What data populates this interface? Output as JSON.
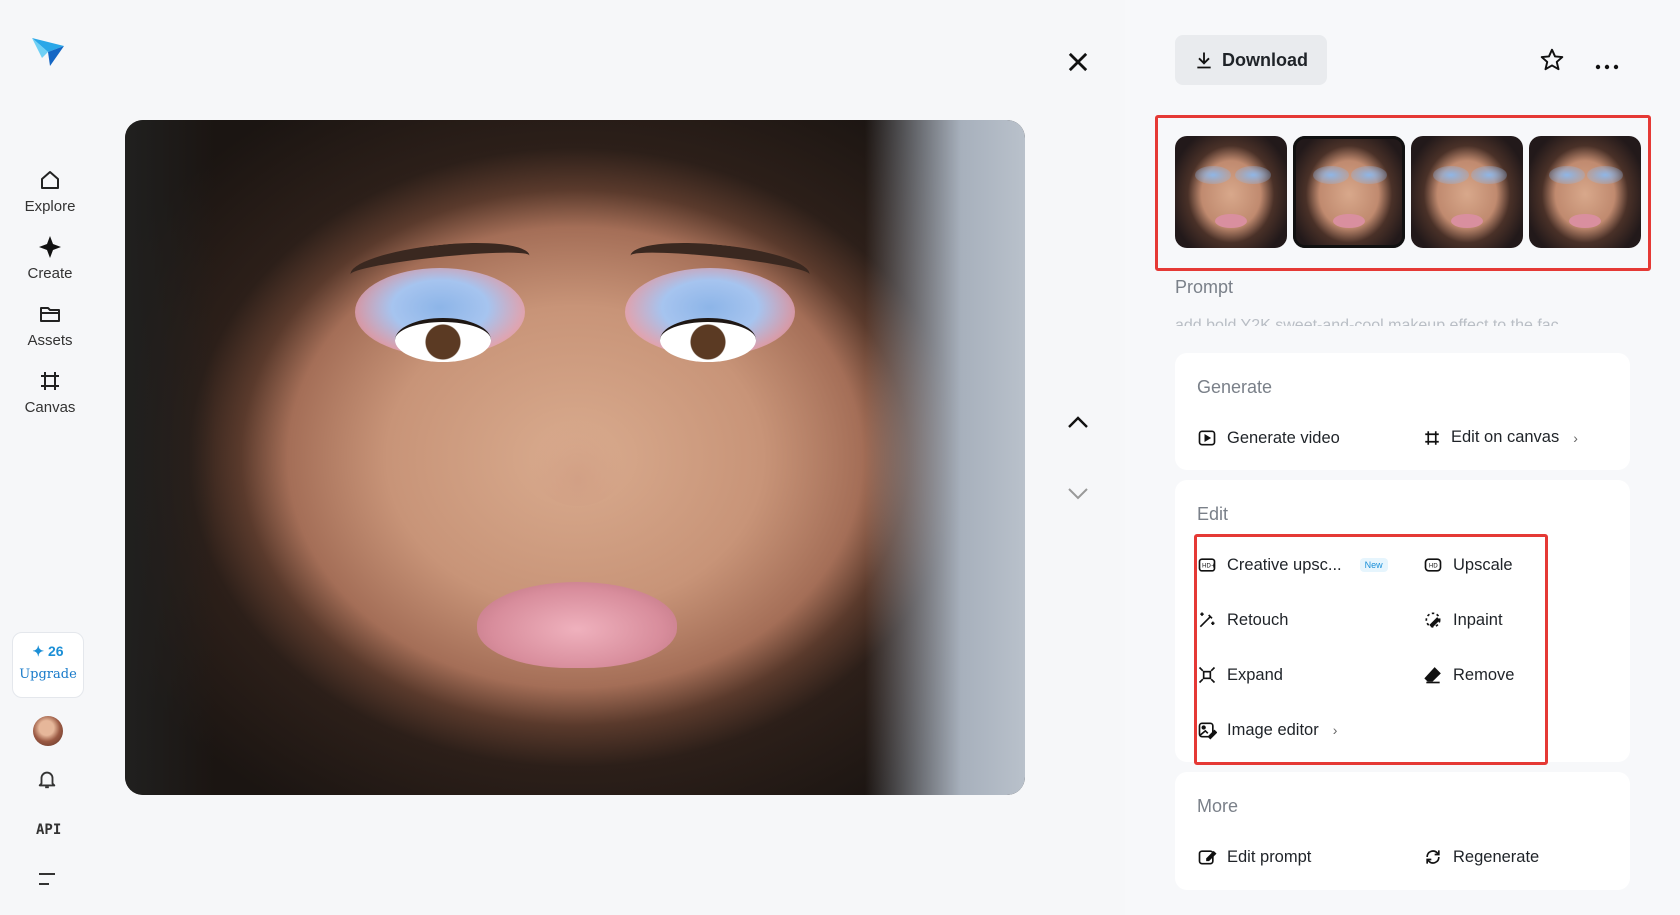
{
  "nav": {
    "items": [
      {
        "label": "Explore",
        "icon": "home-icon"
      },
      {
        "label": "Create",
        "icon": "sparkle-icon"
      },
      {
        "label": "Assets",
        "icon": "folder-icon"
      },
      {
        "label": "Canvas",
        "icon": "canvas-icon"
      }
    ],
    "credits": "26",
    "upgrade_label": "Upgrade",
    "api_label": "API"
  },
  "toolbar": {
    "download_label": "Download"
  },
  "prompt": {
    "label": "Prompt",
    "text": "add bold Y2K sweet-and-cool makeup effect to the fac"
  },
  "generate": {
    "title": "Generate",
    "actions": [
      {
        "label": "Generate video",
        "icon": "play-icon"
      },
      {
        "label": "Edit on canvas",
        "icon": "canvas-icon"
      }
    ]
  },
  "edit": {
    "title": "Edit",
    "actions": [
      {
        "label": "Creative upsc...",
        "icon": "hd-plus-icon",
        "badge": "New"
      },
      {
        "label": "Upscale",
        "icon": "hd-icon"
      },
      {
        "label": "Retouch",
        "icon": "magic-wand-icon"
      },
      {
        "label": "Inpaint",
        "icon": "brush-circle-icon"
      },
      {
        "label": "Expand",
        "icon": "expand-icon"
      },
      {
        "label": "Remove",
        "icon": "eraser-icon"
      },
      {
        "label": "Image editor",
        "icon": "image-edit-icon"
      }
    ]
  },
  "more": {
    "title": "More",
    "actions": [
      {
        "label": "Edit prompt",
        "icon": "edit-prompt-icon"
      },
      {
        "label": "Regenerate",
        "icon": "regenerate-icon"
      }
    ]
  },
  "thumbnails": {
    "count": 4,
    "selected_index": 1
  },
  "colors": {
    "highlight": "#e53935",
    "accent": "#1c8fd6"
  }
}
